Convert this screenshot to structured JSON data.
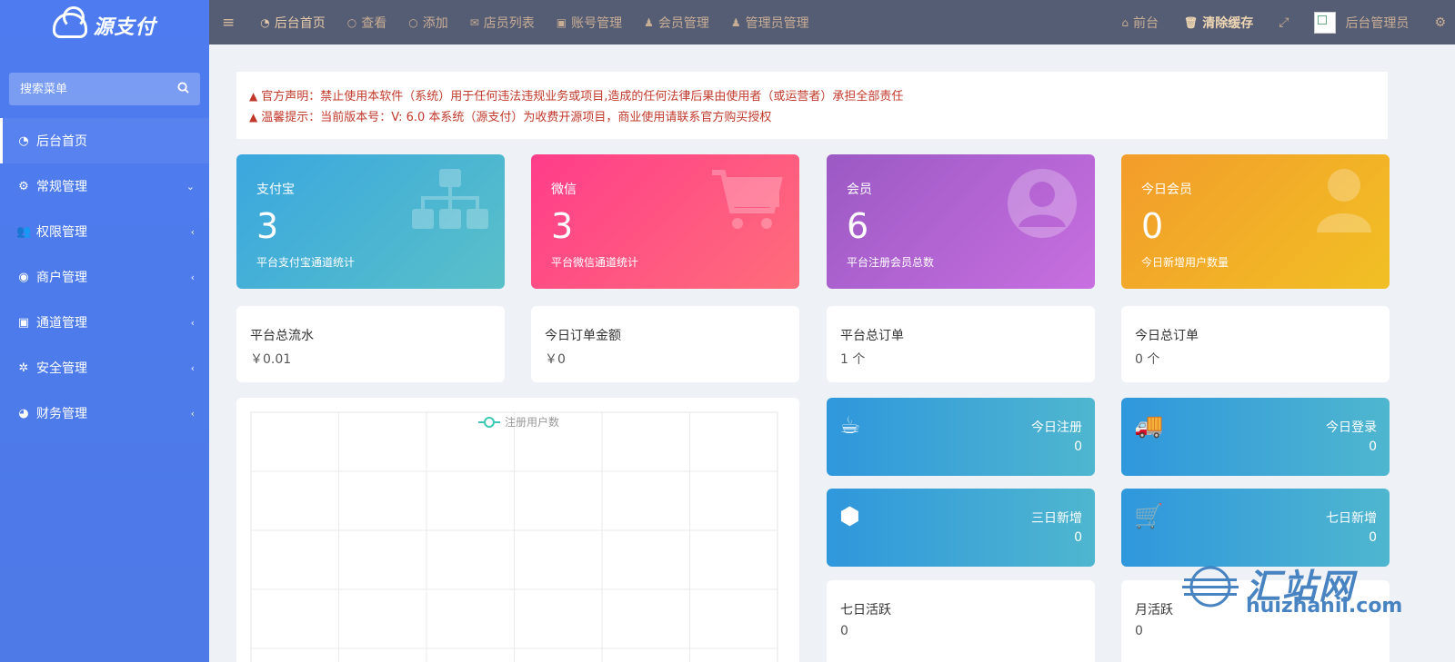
{
  "brand": {
    "logo_text": "源支付"
  },
  "sidebar": {
    "search_placeholder": "搜索菜单",
    "items": [
      {
        "label": "后台首页",
        "icon": "dashboard-icon",
        "glyph": "◔",
        "arrow": ""
      },
      {
        "label": "常规管理",
        "icon": "cogs-icon",
        "glyph": "⚙",
        "arrow": "⌄"
      },
      {
        "label": "权限管理",
        "icon": "users-icon",
        "glyph": "👥",
        "arrow": "‹"
      },
      {
        "label": "商户管理",
        "icon": "user-circle-icon",
        "glyph": "◉",
        "arrow": "‹"
      },
      {
        "label": "通道管理",
        "icon": "channel-icon",
        "glyph": "▣",
        "arrow": "‹"
      },
      {
        "label": "安全管理",
        "icon": "gear-icon",
        "glyph": "✲",
        "arrow": "‹"
      },
      {
        "label": "财务管理",
        "icon": "pie-chart-icon",
        "glyph": "◕",
        "arrow": "‹"
      }
    ]
  },
  "topbar": {
    "nav": [
      {
        "label": "后台首页",
        "glyph": "◔",
        "icon": "dashboard-icon"
      },
      {
        "label": "查看",
        "glyph": "○",
        "icon": "circle-icon"
      },
      {
        "label": "添加",
        "glyph": "○",
        "icon": "circle-icon"
      },
      {
        "label": "店员列表",
        "glyph": "✉",
        "icon": "chat-icon"
      },
      {
        "label": "账号管理",
        "glyph": "▣",
        "icon": "account-icon"
      },
      {
        "label": "会员管理",
        "glyph": "♟",
        "icon": "user-icon"
      },
      {
        "label": "管理员管理",
        "glyph": "♟",
        "icon": "admin-icon"
      }
    ],
    "home_label": "前台",
    "clear_cache_label": "清除缓存",
    "admin_name": "后台管理员"
  },
  "notice": {
    "line1": "官方声明：禁止使用本软件（系统）用于任何违法违规业务或项目,造成的任何法律后果由使用者（或运营者）承担全部责任",
    "line2": "温馨提示：当前版本号：V: 6.0 本系统（源支付）为收费开源项目，商业使用请联系官方购买授权"
  },
  "stat_cards": [
    {
      "title": "支付宝",
      "value": "3",
      "desc": "平台支付宝通道统计",
      "icon": "sitemap-icon"
    },
    {
      "title": "微信",
      "value": "3",
      "desc": "平台微信通道统计",
      "icon": "cart-icon"
    },
    {
      "title": "会员",
      "value": "6",
      "desc": "平台注册会员总数",
      "icon": "user-circle-icon"
    },
    {
      "title": "今日会员",
      "value": "0",
      "desc": "今日新增用户数量",
      "icon": "user-icon"
    }
  ],
  "info_cards": [
    {
      "title": "平台总流水",
      "value": "￥0.01"
    },
    {
      "title": "今日订单金额",
      "value": "￥0"
    },
    {
      "title": "平台总订单",
      "value": "1 个"
    },
    {
      "title": "今日总订单",
      "value": "0 个"
    }
  ],
  "chart_data": {
    "type": "line",
    "legend": "注册用户数",
    "series": [
      {
        "name": "注册用户数",
        "values": []
      }
    ],
    "grid": true
  },
  "mini_cards": [
    {
      "title": "今日注册",
      "value": "0",
      "icon": "coffee-icon",
      "glyph": "☕"
    },
    {
      "title": "今日登录",
      "value": "0",
      "icon": "truck-icon",
      "glyph": "🚚"
    },
    {
      "title": "三日新增",
      "value": "0",
      "icon": "cube-icon",
      "glyph": "⬢"
    },
    {
      "title": "七日新增",
      "value": "0",
      "icon": "cart-download-icon",
      "glyph": "🛒"
    }
  ],
  "active_cards": [
    {
      "title": "七日活跃",
      "value": "0"
    },
    {
      "title": "月活跃",
      "value": "0"
    }
  ],
  "watermark": {
    "cn": "汇站网",
    "en": "huizhanii.com"
  }
}
